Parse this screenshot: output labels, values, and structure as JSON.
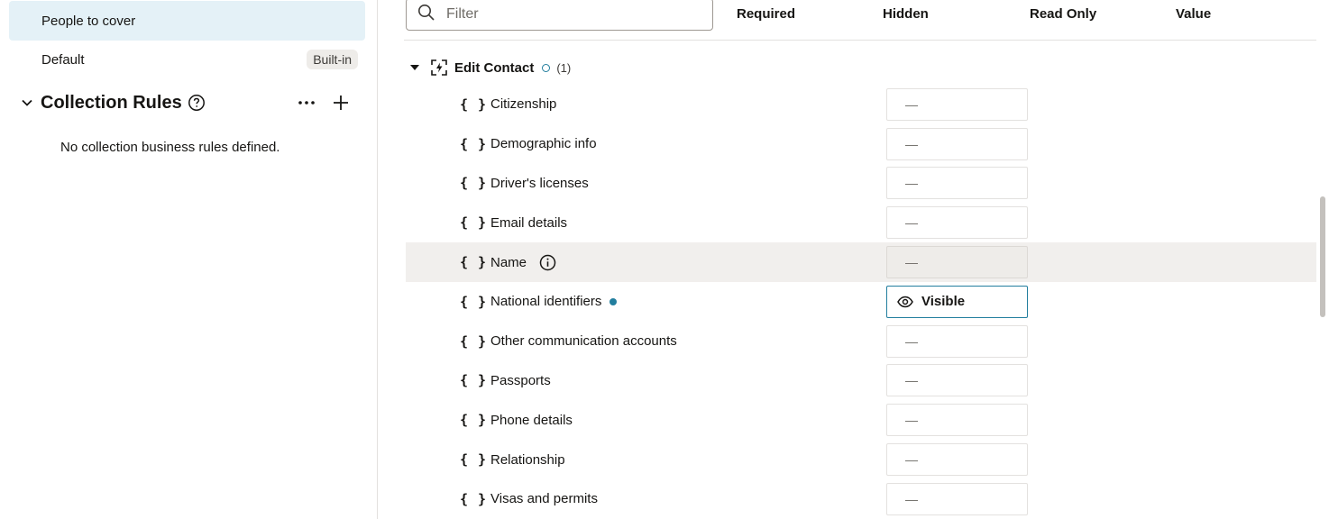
{
  "left": {
    "rules": [
      {
        "label": "People to cover",
        "selected": true,
        "badge": ""
      },
      {
        "label": "Default",
        "selected": false,
        "badge": "Built-in"
      }
    ],
    "collection": {
      "title": "Collection Rules",
      "empty_message": "No collection business rules defined.",
      "icons": {
        "collapse": "chevron-down-icon",
        "help": "question-circle-icon",
        "more": "more-horizontal-icon",
        "add": "plus-icon"
      }
    }
  },
  "right": {
    "filter": {
      "placeholder": "Filter",
      "value": ""
    },
    "columns": {
      "required": "Required",
      "hidden": "Hidden",
      "read_only": "Read Only",
      "value": "Value"
    },
    "group": {
      "title": "Edit Contact",
      "count": "(1)",
      "icon": "action-flow-icon"
    },
    "fields": [
      {
        "label": "Citizenship",
        "hidden": "—"
      },
      {
        "label": "Demographic info",
        "hidden": "—"
      },
      {
        "label": "Driver's licenses",
        "hidden": "—"
      },
      {
        "label": "Email details",
        "hidden": "—"
      },
      {
        "label": "Name",
        "hidden": "—"
      },
      {
        "label": "National identifiers",
        "hidden": "Visible"
      },
      {
        "label": "Other communication accounts",
        "hidden": "—"
      },
      {
        "label": "Passports",
        "hidden": "—"
      },
      {
        "label": "Phone details",
        "hidden": "—"
      },
      {
        "label": "Relationship",
        "hidden": "—"
      },
      {
        "label": "Visas and permits",
        "hidden": "—"
      }
    ],
    "brace_glyph": "{ }"
  },
  "colors": {
    "accent": "#227e9e",
    "selected_bg": "#e4f1f7",
    "hover_bg": "#f1efed"
  }
}
